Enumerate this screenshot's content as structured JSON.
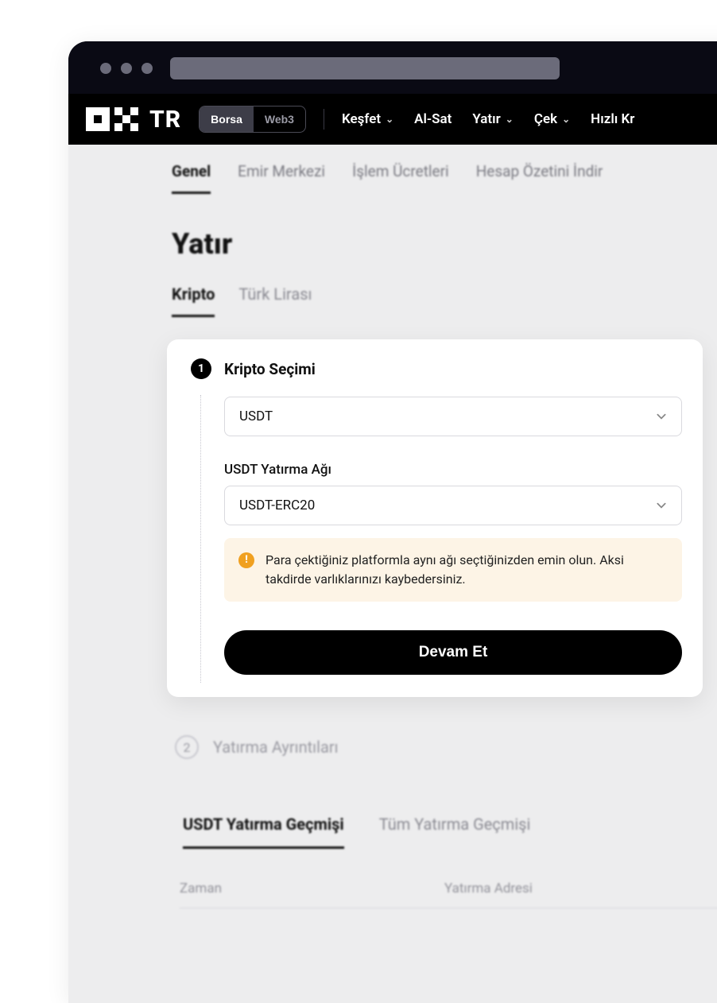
{
  "logo_text": "TR",
  "mode_toggle": {
    "borsa": "Borsa",
    "web3": "Web3"
  },
  "top_nav": {
    "kesfet": "Keşfet",
    "alsat": "Al-Sat",
    "yatir": "Yatır",
    "cek": "Çek",
    "hizli": "Hızlı Kr"
  },
  "sub_nav": {
    "genel": "Genel",
    "emir": "Emir Merkezi",
    "ucret": "İşlem Ücretleri",
    "hesap": "Hesap Özetini İndir"
  },
  "page_title": "Yatır",
  "currency_tabs": {
    "kripto": "Kripto",
    "try": "Türk Lirası"
  },
  "step1": {
    "number": "1",
    "title": "Kripto Seçimi",
    "crypto_value": "USDT",
    "network_label": "USDT Yatırma Ağı",
    "network_value": "USDT-ERC20",
    "warning": "Para çektiğiniz platformla aynı ağı seçtiğinizden emin olun. Aksi takdirde varlıklarınızı kaybedersiniz.",
    "continue": "Devam Et"
  },
  "step2": {
    "number": "2",
    "title": "Yatırma Ayrıntıları"
  },
  "history_tabs": {
    "usdt": "USDT Yatırma Geçmişi",
    "all": "Tüm Yatırma Geçmişi"
  },
  "table": {
    "time": "Zaman",
    "address": "Yatırma Adresi"
  }
}
